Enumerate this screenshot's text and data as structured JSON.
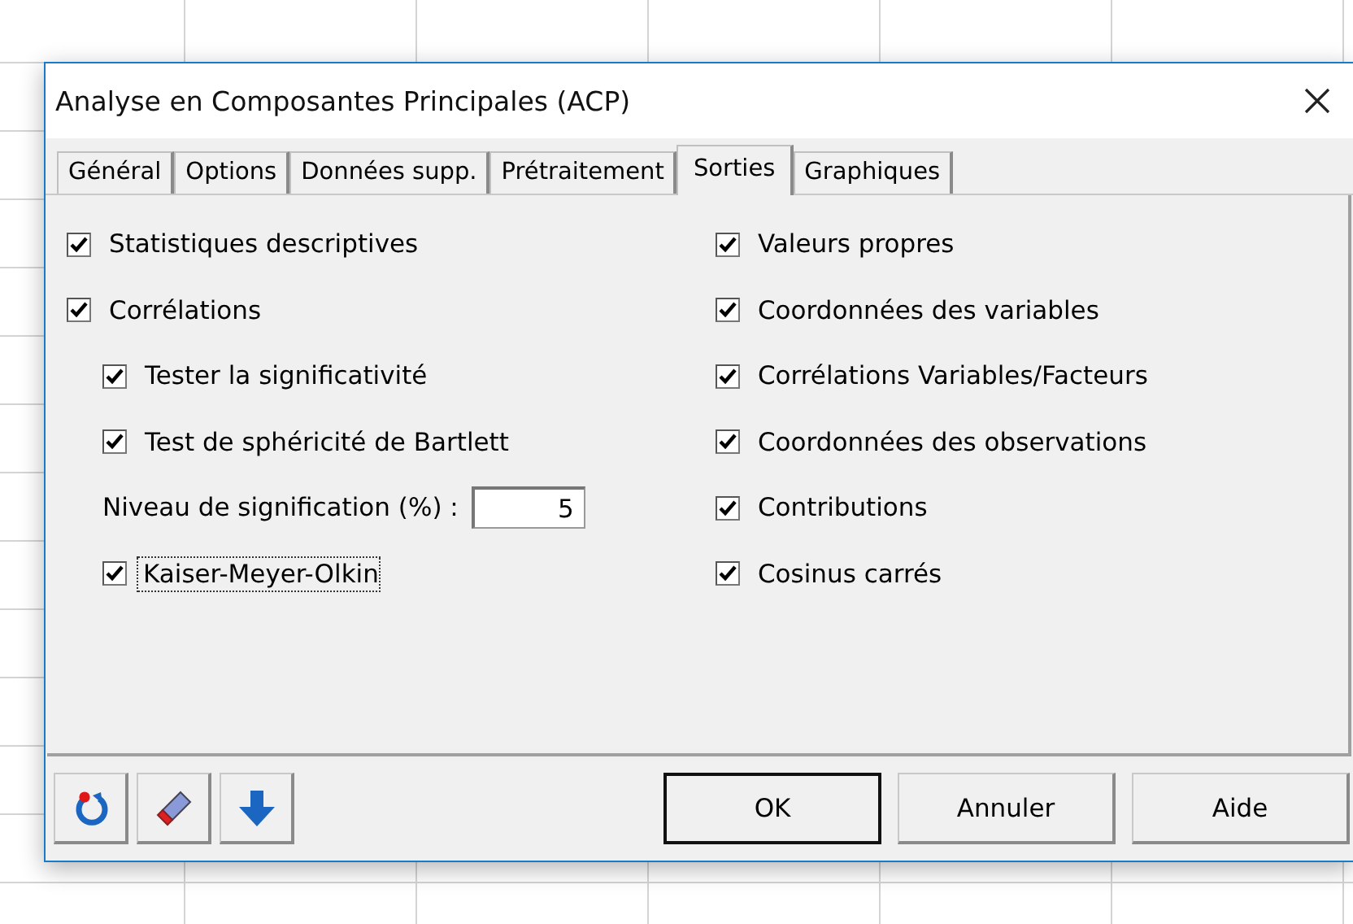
{
  "window": {
    "title": "Analyse en Composantes Principales (ACP)"
  },
  "tabs": [
    {
      "label": "Général",
      "selected": false
    },
    {
      "label": "Options",
      "selected": false
    },
    {
      "label": "Données supp.",
      "selected": false
    },
    {
      "label": "Prétraitement",
      "selected": false
    },
    {
      "label": "Sorties",
      "selected": true
    },
    {
      "label": "Graphiques",
      "selected": false
    }
  ],
  "left_options": [
    {
      "kind": "checkbox",
      "label": "Statistiques descriptives",
      "checked": true,
      "focused": false
    },
    {
      "kind": "checkbox",
      "label": "Corrélations",
      "checked": true,
      "focused": false,
      "children": [
        {
          "kind": "checkbox",
          "label": "Tester la significativité",
          "checked": true,
          "focused": false
        },
        {
          "kind": "checkbox",
          "label": "Test de sphéricité de Bartlett",
          "checked": true,
          "focused": false
        },
        {
          "kind": "number_field",
          "label": "Niveau de signification (%) :",
          "value": "5"
        },
        {
          "kind": "checkbox",
          "label": "Kaiser-Meyer-Olkin",
          "checked": true,
          "focused": true
        }
      ]
    }
  ],
  "right_options": [
    {
      "kind": "checkbox",
      "label": "Valeurs propres",
      "checked": true,
      "focused": false
    },
    {
      "kind": "checkbox",
      "label": "Coordonnées des variables",
      "checked": true,
      "focused": false
    },
    {
      "kind": "checkbox",
      "label": "Corrélations Variables/Facteurs",
      "checked": true,
      "focused": false
    },
    {
      "kind": "checkbox",
      "label": "Coordonnées des observations",
      "checked": true,
      "focused": false
    },
    {
      "kind": "checkbox",
      "label": "Contributions",
      "checked": true,
      "focused": false
    },
    {
      "kind": "checkbox",
      "label": "Cosinus carrés",
      "checked": true,
      "focused": false
    }
  ],
  "buttons": [
    {
      "label": "OK",
      "default": true
    },
    {
      "label": "Annuler",
      "default": false
    },
    {
      "label": "Aide",
      "default": false
    }
  ]
}
